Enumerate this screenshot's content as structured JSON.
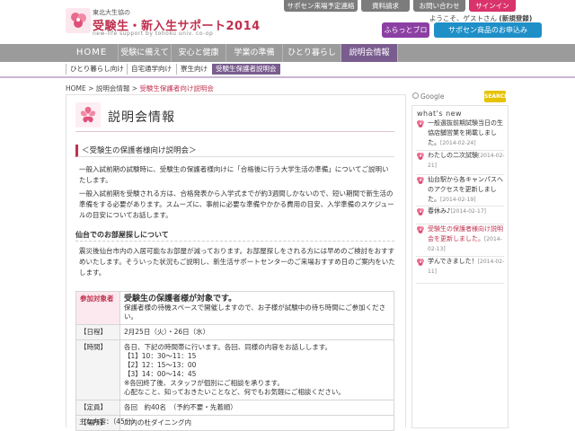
{
  "header": {
    "org": "東北大生協の",
    "title": "受験生・新入生サポート2014",
    "subtitle": "new-life support by tohoku univ. co-op",
    "top_buttons": [
      "サポセン来場予定連絡",
      "資料請求",
      "お問い合わせ",
      "サインイン"
    ],
    "welcome_prefix": "ようこそ、ゲストさん",
    "welcome_link": "(新規登録)",
    "blog_button": "ふらっとブログ",
    "shop_button": "サポセン商品のお申込み"
  },
  "nav": {
    "items": [
      "HOME",
      "受験に備えて",
      "安心と健康",
      "学業の準備",
      "ひとり暮らし",
      "説明会情報"
    ],
    "search_placeholder": "Google",
    "search_button": "SEARCH"
  },
  "subnav": {
    "items": [
      "ひとり暮らし向け",
      "自宅通学向け",
      "寮生向け",
      "受験生保護者説明会"
    ]
  },
  "breadcrumb": {
    "home": "HOME",
    "sep1": " > ",
    "parent": "説明会情報",
    "sep2": " > ",
    "current": "受験生保護者向け説明会"
  },
  "main": {
    "title": "説明会情報",
    "section_heading": "＜受験生の保護者様向け説明会＞",
    "para1": "一般入試前期の試験時に、受験生の保護者様向けに「合格後に行う大学生活の準備」についてご説明いたします。",
    "para2": "一般入試前期を受験される方は、合格発表から入学式までが約3週間しかないので、短い期間で新生活の準備をする必要があります。スムーズに、事前に必要な準備やかかる費用の目安、入学準備のスケジュールの目安についてお話します。",
    "sub_heading": "仙台でのお部屋探しについて",
    "para3": "震災後仙台市内の入居可能なお部屋が減っております。お部屋探しをされる方には早めのご検討をおすすめいたします。そういった状況もご説明し、新生活サポートセンターのご来場おすすめ日のご案内をいたします。",
    "table": {
      "target_label": "参加対象者",
      "target_value": "受験生の保護者様が対象です。",
      "target_note": "保護者様の待機スペースで開催しますので、お子様が試験中の待ち時間にご参加ください。",
      "date_label": "【日程】",
      "date_value": "2月25日（火）・26日（水）",
      "time_label": "【時間】",
      "time_lines": [
        "各日、下記の時間帯に行います。各回、同様の内容をお話しします。",
        "【1】10：30〜11：15",
        "【2】12：15〜13：00",
        "【3】14：00〜14：45",
        "※各回終了後、スタッフが個別にご相談を承ります。",
        "心配なこと、知っておきたいことなど、何でもお気軽にご相談ください。"
      ],
      "capacity_label": "【定員】",
      "capacity_value": "各回　約40名　（予約不要・先着順）",
      "place_label": "【場所】",
      "place_value": "川内の杜ダイニング内"
    },
    "bottom_note": "主な内容：（45分）"
  },
  "sidebar": {
    "title": "what's new",
    "news": [
      {
        "text": "一般選抜前期試験当日の生協店舗営業を掲載しました。",
        "date": "[2014-02-24]",
        "pink": false
      },
      {
        "text": "わたしの二次試験",
        "date": "[2014-02-21]",
        "pink": false
      },
      {
        "text": "仙台駅から各キャンパスへのアクセスを更新しました。",
        "date": "[2014-02-19]",
        "pink": false
      },
      {
        "text": "春休み♪",
        "date": "[2014-02-17]",
        "pink": false
      },
      {
        "text": "受験生の保護者様向け説明会を更新しました。",
        "date": "[2014-02-13]",
        "pink": true
      },
      {
        "text": "学んできました！",
        "date": "[2014-02-11]",
        "pink": false
      }
    ]
  }
}
